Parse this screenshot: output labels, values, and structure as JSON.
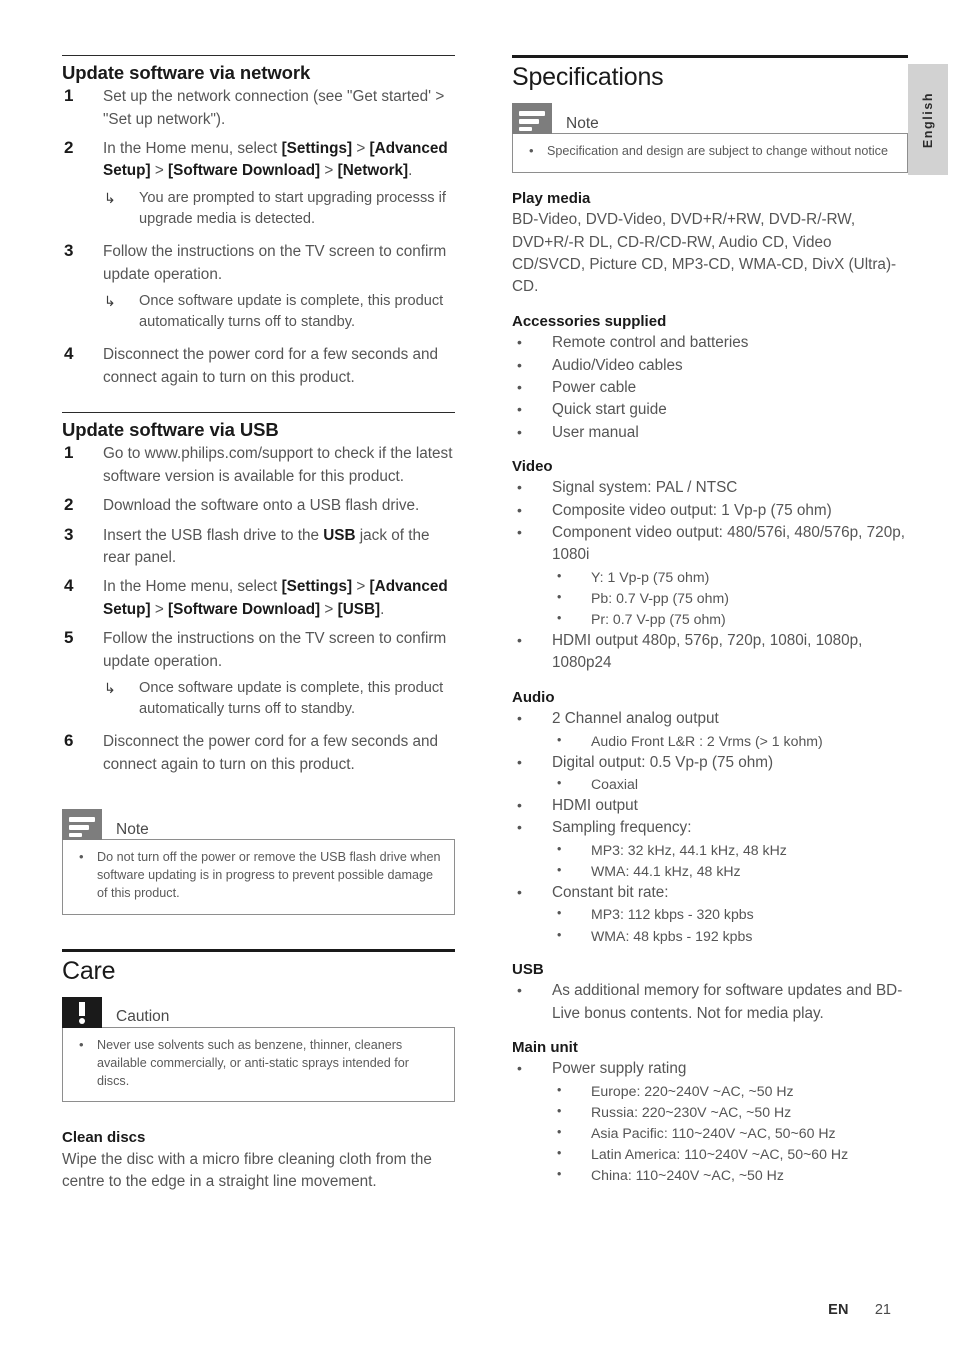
{
  "page": {
    "language_tab": "English",
    "footer": {
      "locale": "EN",
      "page_number": "21"
    }
  },
  "left_column": {
    "section_network": {
      "heading": "Update software via network",
      "steps": [
        {
          "num": "1",
          "text": "Set up the network connection (see \"Get started' > \"Set up network\")."
        },
        {
          "num": "2",
          "text_html": "In the Home menu, select <b>[Settings]</b> > <b>[Advanced Setup]</b> > <b>[Software Download]</b> > <b>[Network]</b>.",
          "arrow_note": "You are prompted to start upgrading processs if upgrade media is detected."
        },
        {
          "num": "3",
          "text": "Follow the instructions on the TV screen to confirm update operation.",
          "arrow_note": "Once software update is complete, this product automatically turns off to standby."
        },
        {
          "num": "4",
          "text": "Disconnect the power cord for a few seconds and connect again to turn on this product."
        }
      ]
    },
    "section_usb": {
      "heading": "Update software via USB",
      "steps": [
        {
          "num": "1",
          "text": "Go to www.philips.com/support to check if the latest software version is available for this product."
        },
        {
          "num": "2",
          "text": "Download the software onto a USB flash drive."
        },
        {
          "num": "3",
          "text_html": "Insert the USB flash drive to the <b>USB</b> jack of the rear panel."
        },
        {
          "num": "4",
          "text_html": "In the Home menu, select <b>[Settings]</b> > <b>[Advanced Setup]</b> > <b>[Software Download]</b> > <b>[USB]</b>."
        },
        {
          "num": "5",
          "text": "Follow the instructions on the TV screen to confirm update operation.",
          "arrow_note": "Once software update is complete, this product automatically turns off to standby."
        },
        {
          "num": "6",
          "text": "Disconnect the power cord for a few seconds and connect again to turn on this product."
        }
      ]
    },
    "note_usb": {
      "label": "Note",
      "icon": "note-lines-icon",
      "items": [
        "Do not turn off the power or remove the USB flash drive when software updating is in progress to prevent possible damage of this product."
      ]
    },
    "section_care": {
      "heading": "Care",
      "caution": {
        "label": "Caution",
        "icon": "exclamation-icon",
        "items": [
          "Never use solvents such as benzene, thinner, cleaners available commercially, or anti-static sprays intended for discs."
        ]
      },
      "clean_discs": {
        "heading": "Clean discs",
        "text": "Wipe the disc with a micro fibre cleaning cloth from the centre to the edge in a straight line movement."
      }
    }
  },
  "right_column": {
    "heading": "Specifications",
    "note": {
      "label": "Note",
      "icon": "note-lines-icon",
      "items": [
        "Specification and design are subject to change without notice"
      ]
    },
    "specs": [
      {
        "title": "Play media",
        "paragraph": "BD-Video, DVD-Video, DVD+R/+RW, DVD-R/-RW, DVD+R/-R DL, CD-R/CD-RW, Audio CD, Video CD/SVCD, Picture CD, MP3-CD, WMA-CD, DivX (Ultra)-CD."
      },
      {
        "title": "Accessories supplied",
        "bullets": [
          {
            "text": "Remote control and batteries"
          },
          {
            "text": "Audio/Video cables"
          },
          {
            "text": "Power cable"
          },
          {
            "text": "Quick start guide"
          },
          {
            "text": "User manual"
          }
        ]
      },
      {
        "title": "Video",
        "bullets": [
          {
            "text": "Signal system: PAL / NTSC"
          },
          {
            "text": "Composite video output: 1 Vp-p (75 ohm)"
          },
          {
            "text": "Component video output: 480/576i, 480/576p, 720p, 1080i",
            "sub": [
              "Y: 1 Vp-p (75 ohm)",
              "Pb: 0.7 V-pp (75 ohm)",
              "Pr: 0.7 V-pp (75 ohm)"
            ]
          },
          {
            "text": "HDMI output 480p, 576p, 720p, 1080i, 1080p, 1080p24"
          }
        ]
      },
      {
        "title": "Audio",
        "bullets": [
          {
            "text": "2 Channel analog output",
            "sub": [
              "Audio Front L&R : 2 Vrms (> 1 kohm)"
            ]
          },
          {
            "text": "Digital output: 0.5 Vp-p (75 ohm)",
            "sub": [
              "Coaxial"
            ]
          },
          {
            "text": "HDMI output"
          },
          {
            "text": "Sampling frequency:",
            "sub": [
              "MP3: 32 kHz, 44.1 kHz, 48 kHz",
              "WMA: 44.1 kHz, 48 kHz"
            ]
          },
          {
            "text": "Constant bit rate:",
            "sub": [
              "MP3: 112 kbps - 320 kpbs",
              "WMA: 48 kpbs - 192 kpbs"
            ]
          }
        ]
      },
      {
        "title": "USB",
        "bullets": [
          {
            "text": "As additional memory for software updates and BD-Live bonus contents. Not for media play."
          }
        ]
      },
      {
        "title": "Main unit",
        "bullets": [
          {
            "text": "Power supply rating",
            "sub": [
              "Europe: 220~240V ~AC, ~50 Hz",
              "Russia: 220~230V ~AC, ~50 Hz",
              "Asia Pacific: 110~240V ~AC, 50~60 Hz",
              "Latin America: 110~240V ~AC, 50~60 Hz",
              "China: 110~240V ~AC, ~50 Hz"
            ]
          }
        ]
      }
    ]
  }
}
